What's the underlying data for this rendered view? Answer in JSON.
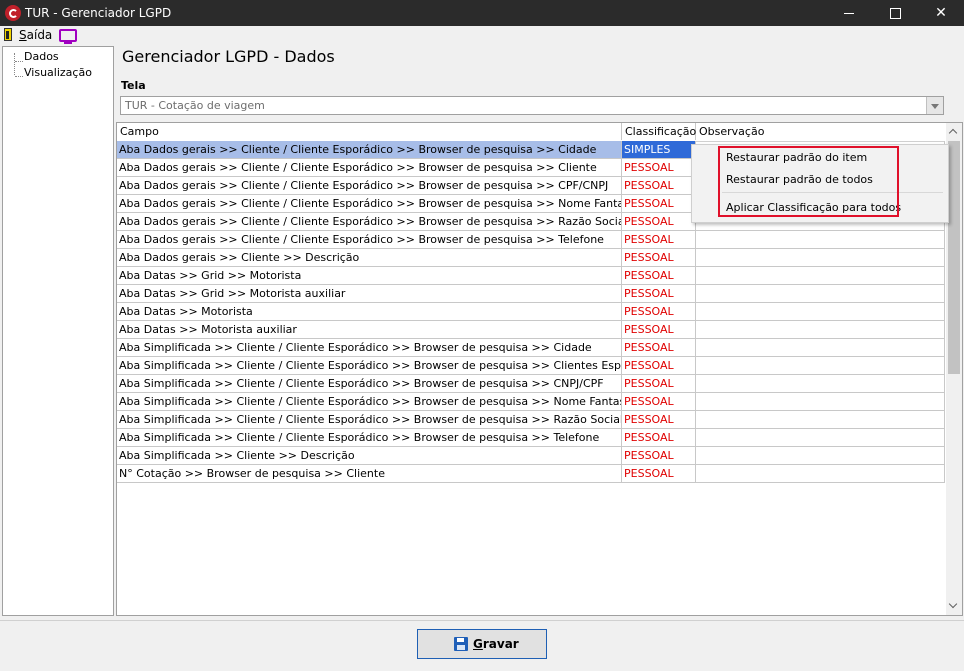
{
  "window": {
    "title": "TUR - Gerenciador LGPD",
    "controls": {
      "minimize": "minimize-icon",
      "maximize": "maximize-icon",
      "close": "close-icon"
    }
  },
  "menubar": {
    "exit_label_underlined": "S",
    "exit_label_rest": "aída",
    "icons": [
      "exit-door-icon",
      "monitor-icon"
    ]
  },
  "tree": {
    "items": [
      {
        "label": "Dados"
      },
      {
        "label": "Visualização"
      }
    ]
  },
  "main": {
    "title": "Gerenciador LGPD - Dados",
    "tela_label": "Tela",
    "tela_value": "TUR - Cotação de viagem"
  },
  "grid": {
    "columns": [
      "Campo",
      "Classificação",
      "Observação"
    ],
    "rows": [
      {
        "campo": "Aba Dados gerais >> Cliente / Cliente Esporádico >> Browser de pesquisa >> Cidade",
        "classificacao": "SIMPLES",
        "observacao": ""
      },
      {
        "campo": "Aba Dados gerais >> Cliente / Cliente Esporádico >> Browser de pesquisa >> Cliente",
        "classificacao": "PESSOAL",
        "observacao": ""
      },
      {
        "campo": "Aba Dados gerais >> Cliente / Cliente Esporádico >> Browser de pesquisa >> CPF/CNPJ",
        "classificacao": "PESSOAL",
        "observacao": ""
      },
      {
        "campo": "Aba Dados gerais >> Cliente / Cliente Esporádico >> Browser de pesquisa >> Nome Fantasia",
        "classificacao": "PESSOAL",
        "observacao": ""
      },
      {
        "campo": "Aba Dados gerais >> Cliente / Cliente Esporádico >> Browser de pesquisa >> Razão Social",
        "classificacao": "PESSOAL",
        "observacao": ""
      },
      {
        "campo": "Aba Dados gerais >> Cliente / Cliente Esporádico >> Browser de pesquisa >> Telefone",
        "classificacao": "PESSOAL",
        "observacao": ""
      },
      {
        "campo": "Aba Dados gerais >> Cliente >> Descrição",
        "classificacao": "PESSOAL",
        "observacao": ""
      },
      {
        "campo": "Aba Datas >> Grid >> Motorista",
        "classificacao": "PESSOAL",
        "observacao": ""
      },
      {
        "campo": "Aba Datas >> Grid >> Motorista auxiliar",
        "classificacao": "PESSOAL",
        "observacao": ""
      },
      {
        "campo": "Aba Datas >> Motorista",
        "classificacao": "PESSOAL",
        "observacao": ""
      },
      {
        "campo": "Aba Datas >> Motorista auxiliar",
        "classificacao": "PESSOAL",
        "observacao": ""
      },
      {
        "campo": "Aba Simplificada >> Cliente / Cliente Esporádico >> Browser de pesquisa >> Cidade",
        "classificacao": "PESSOAL",
        "observacao": ""
      },
      {
        "campo": "Aba Simplificada >> Cliente / Cliente Esporádico >> Browser de pesquisa >> Clientes Esporádicos >> No...",
        "classificacao": "PESSOAL",
        "observacao": ""
      },
      {
        "campo": "Aba Simplificada >> Cliente / Cliente Esporádico >> Browser de pesquisa >> CNPJ/CPF",
        "classificacao": "PESSOAL",
        "observacao": ""
      },
      {
        "campo": "Aba Simplificada >> Cliente / Cliente Esporádico >> Browser de pesquisa >> Nome Fantasia",
        "classificacao": "PESSOAL",
        "observacao": ""
      },
      {
        "campo": "Aba Simplificada >> Cliente / Cliente Esporádico >> Browser de pesquisa >> Razão Social",
        "classificacao": "PESSOAL",
        "observacao": ""
      },
      {
        "campo": "Aba Simplificada >> Cliente / Cliente Esporádico >> Browser de pesquisa >> Telefone",
        "classificacao": "PESSOAL",
        "observacao": ""
      },
      {
        "campo": "Aba Simplificada >> Cliente >> Descrição",
        "classificacao": "PESSOAL",
        "observacao": ""
      },
      {
        "campo": "N° Cotação >> Browser de pesquisa >> Cliente",
        "classificacao": "PESSOAL",
        "observacao": ""
      }
    ],
    "selected_row": 0
  },
  "context_menu": {
    "items": [
      "Restaurar padrão do item",
      "Restaurar padrão de todos",
      "Aplicar Classificação para todos"
    ]
  },
  "footer": {
    "save_label_underlined": "G",
    "save_label_rest": "ravar"
  },
  "colors": {
    "titlebar": "#2b2b2b",
    "selection": "#2f6ad8",
    "row_highlight": "#a7bde8",
    "pessoal_text": "#e00000",
    "highlight_box": "#e0102a"
  }
}
